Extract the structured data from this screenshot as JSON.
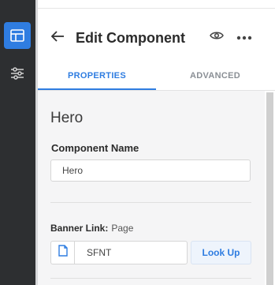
{
  "header": {
    "back_icon": "arrow-left-icon",
    "title": "Edit Component",
    "preview_icon": "eye-icon",
    "more_icon": "more-horizontal-icon"
  },
  "rail": {
    "items": [
      {
        "icon": "layout-icon",
        "active": true
      },
      {
        "icon": "sliders-icon",
        "active": false
      }
    ]
  },
  "tabs": [
    {
      "label": "PROPERTIES",
      "active": true
    },
    {
      "label": "ADVANCED",
      "active": false
    }
  ],
  "component": {
    "section_title": "Hero",
    "name_label": "Component Name",
    "name_value": "Hero",
    "banner_label": "Banner Link:",
    "banner_type": "Page",
    "banner_value": "SFNT",
    "lookup_label": "Look Up"
  },
  "colors": {
    "accent": "#2f7de1",
    "rail": "#2d2f31",
    "content_bg": "#f5f5f6"
  }
}
